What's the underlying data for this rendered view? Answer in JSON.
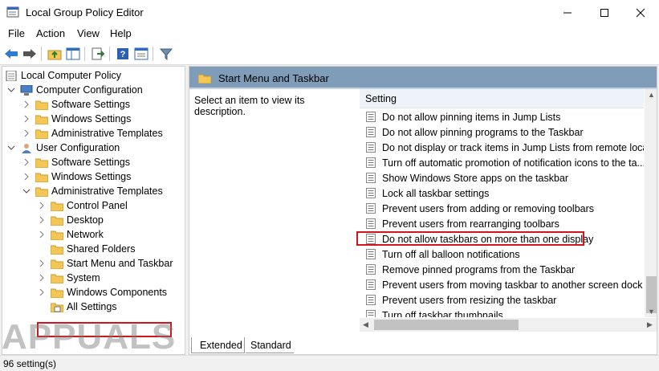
{
  "window": {
    "title": "Local Group Policy Editor"
  },
  "menu": [
    "File",
    "Action",
    "View",
    "Help"
  ],
  "tree": {
    "items": [
      {
        "label": "Local Computer Policy",
        "icon": "computer-policy-icon"
      },
      {
        "label": "Computer Configuration",
        "icon": "computer-icon"
      },
      {
        "label": "Software Settings",
        "icon": "folder-icon"
      },
      {
        "label": "Windows Settings",
        "icon": "folder-icon"
      },
      {
        "label": "Administrative Templates",
        "icon": "folder-icon"
      },
      {
        "label": "User Configuration",
        "icon": "user-icon"
      },
      {
        "label": "Software Settings",
        "icon": "folder-icon"
      },
      {
        "label": "Windows Settings",
        "icon": "folder-icon"
      },
      {
        "label": "Administrative Templates",
        "icon": "folder-icon"
      },
      {
        "label": "Control Panel",
        "icon": "folder-icon"
      },
      {
        "label": "Desktop",
        "icon": "folder-icon"
      },
      {
        "label": "Network",
        "icon": "folder-icon"
      },
      {
        "label": "Shared Folders",
        "icon": "folder-icon"
      },
      {
        "label": "Start Menu and Taskbar",
        "icon": "folder-icon",
        "selected": true
      },
      {
        "label": "System",
        "icon": "folder-icon"
      },
      {
        "label": "Windows Components",
        "icon": "folder-icon"
      },
      {
        "label": "All Settings",
        "icon": "all-settings-icon"
      }
    ]
  },
  "right": {
    "header": "Start Menu and Taskbar",
    "description": "Select an item to view its description.",
    "column": "Setting",
    "settings": [
      "Do not allow pinning items in Jump Lists",
      "Do not allow pinning programs to the Taskbar",
      "Do not display or track items in Jump Lists from remote loca...",
      "Turn off automatic promotion of notification icons to the ta...",
      "Show Windows Store apps on the taskbar",
      "Lock all taskbar settings",
      "Prevent users from adding or removing toolbars",
      "Prevent users from rearranging toolbars",
      "Do not allow taskbars on more than one display",
      "Turn off all balloon notifications",
      "Remove pinned programs from the Taskbar",
      "Prevent users from moving taskbar to another screen dock l...",
      "Prevent users from resizing the taskbar",
      "Turn off taskbar thumbnails"
    ],
    "highlighted_setting": "Do not allow taskbars on more than one display",
    "tabs": [
      "Extended",
      "Standard"
    ],
    "active_tab": "Extended"
  },
  "status": "96 setting(s)",
  "watermark": "APPUALS",
  "colors": {
    "header_blue": "#7f9db9",
    "highlight_red": "#d0161c",
    "folder_yellow": "#f3c655"
  }
}
